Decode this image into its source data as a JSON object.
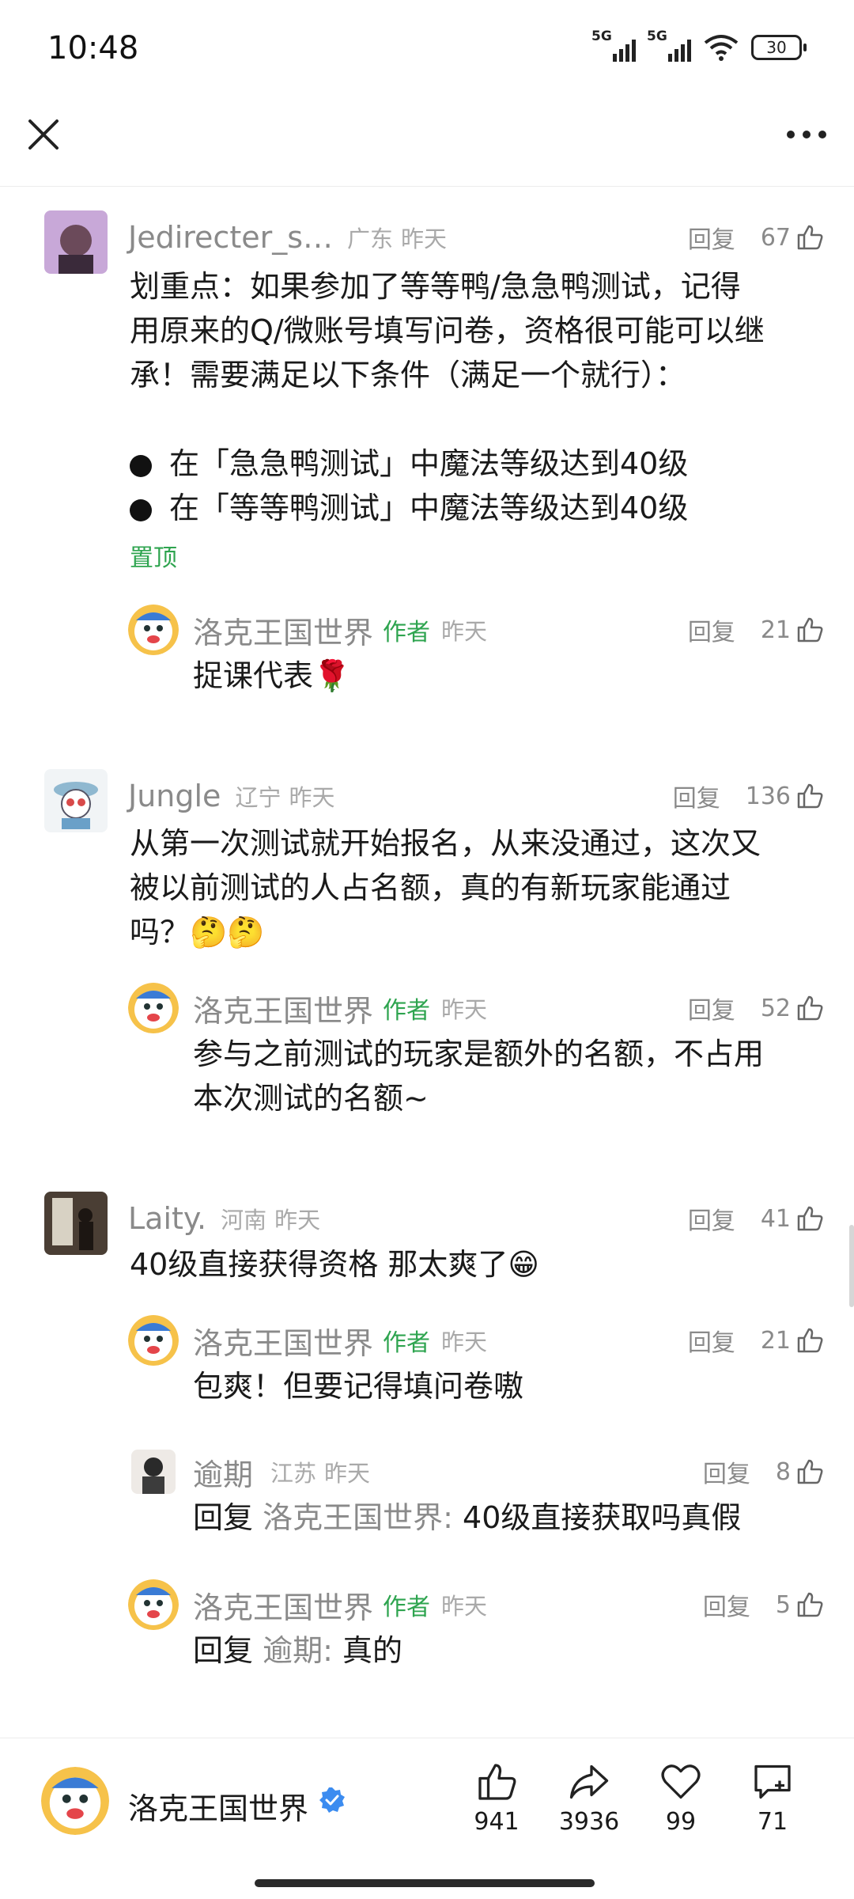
{
  "status": {
    "time": "10:48",
    "net1": "5G",
    "net2": "5G",
    "battery": "30"
  },
  "comments": [
    {
      "user": "Jedirecter_s…",
      "location": "广东",
      "time": "昨天",
      "reply_label": "回复",
      "likes": "67",
      "lines": [
        "划重点：如果参加了等等鸭/急急鸭测试，记得",
        "用原来的Q/微账号填写问卷，资格很可能可以继",
        "承！需要满足以下条件（满足一个就行）："
      ],
      "bullets": [
        "在「急急鸭测试」中魔法等级达到40级",
        "在「等等鸭测试」中魔法等级达到40级"
      ],
      "pinned": "置顶",
      "replies": [
        {
          "user": "洛克王国世界",
          "author_tag": "作者",
          "time": "昨天",
          "reply_label": "回复",
          "likes": "21",
          "text": "捉课代表🌹"
        }
      ]
    },
    {
      "user": "Jungle",
      "location": "辽宁",
      "time": "昨天",
      "reply_label": "回复",
      "likes": "136",
      "lines": [
        "从第一次测试就开始报名，从来没通过，这次又",
        "被以前测试的人占名额，真的有新玩家能通过",
        "吗？🤔🤔"
      ],
      "replies": [
        {
          "user": "洛克王国世界",
          "author_tag": "作者",
          "time": "昨天",
          "reply_label": "回复",
          "likes": "52",
          "lines": [
            "参与之前测试的玩家是额外的名额，不占用",
            "本次测试的名额~"
          ]
        }
      ]
    },
    {
      "user": "Laity.",
      "location": "河南",
      "time": "昨天",
      "reply_label": "回复",
      "likes": "41",
      "lines": [
        "40级直接获得资格 那太爽了😁"
      ],
      "replies": [
        {
          "user": "洛克王国世界",
          "author_tag": "作者",
          "time": "昨天",
          "reply_label": "回复",
          "likes": "21",
          "text": "包爽！但要记得填问卷嗷"
        },
        {
          "user": "逾期",
          "location": "江苏",
          "time": "昨天",
          "reply_label": "回复",
          "likes": "8",
          "prefix": "回复",
          "target": "洛克王国世界:",
          "text": "40级直接获取吗真假"
        },
        {
          "user": "洛克王国世界",
          "author_tag": "作者",
          "time": "昨天",
          "reply_label": "回复",
          "likes": "5",
          "prefix": "回复",
          "target": "逾期:",
          "text": "真的"
        }
      ]
    }
  ],
  "bottom": {
    "account": "洛克王国世界",
    "likes": "941",
    "shares": "3936",
    "favorites": "99",
    "comments": "71"
  },
  "colors": {
    "accent_green": "#2ea44f",
    "meta_gray": "#a9a9a9",
    "verified_blue": "#3c8cf0"
  }
}
